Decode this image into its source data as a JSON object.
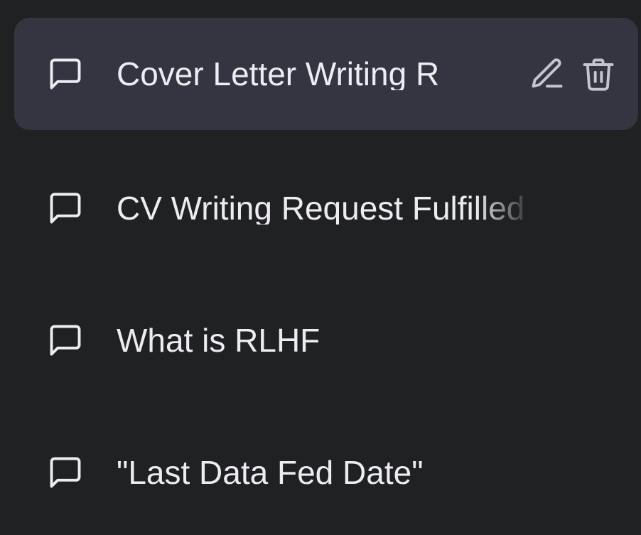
{
  "conversations": [
    {
      "title": "Cover Letter Writing R",
      "icon": "chat-bubble-icon",
      "active": true,
      "actions": [
        {
          "icon": "pencil-icon"
        },
        {
          "icon": "trash-icon"
        }
      ]
    },
    {
      "title": "CV Writing Request Fulfilled",
      "icon": "chat-bubble-icon",
      "active": false
    },
    {
      "title": "What is RLHF",
      "icon": "chat-bubble-icon",
      "active": false
    },
    {
      "title": "\"Last Data Fed Date\"",
      "icon": "chat-bubble-icon",
      "active": false
    }
  ],
  "colors": {
    "background": "#202123",
    "active_background": "#343541",
    "text": "#ececf1"
  }
}
